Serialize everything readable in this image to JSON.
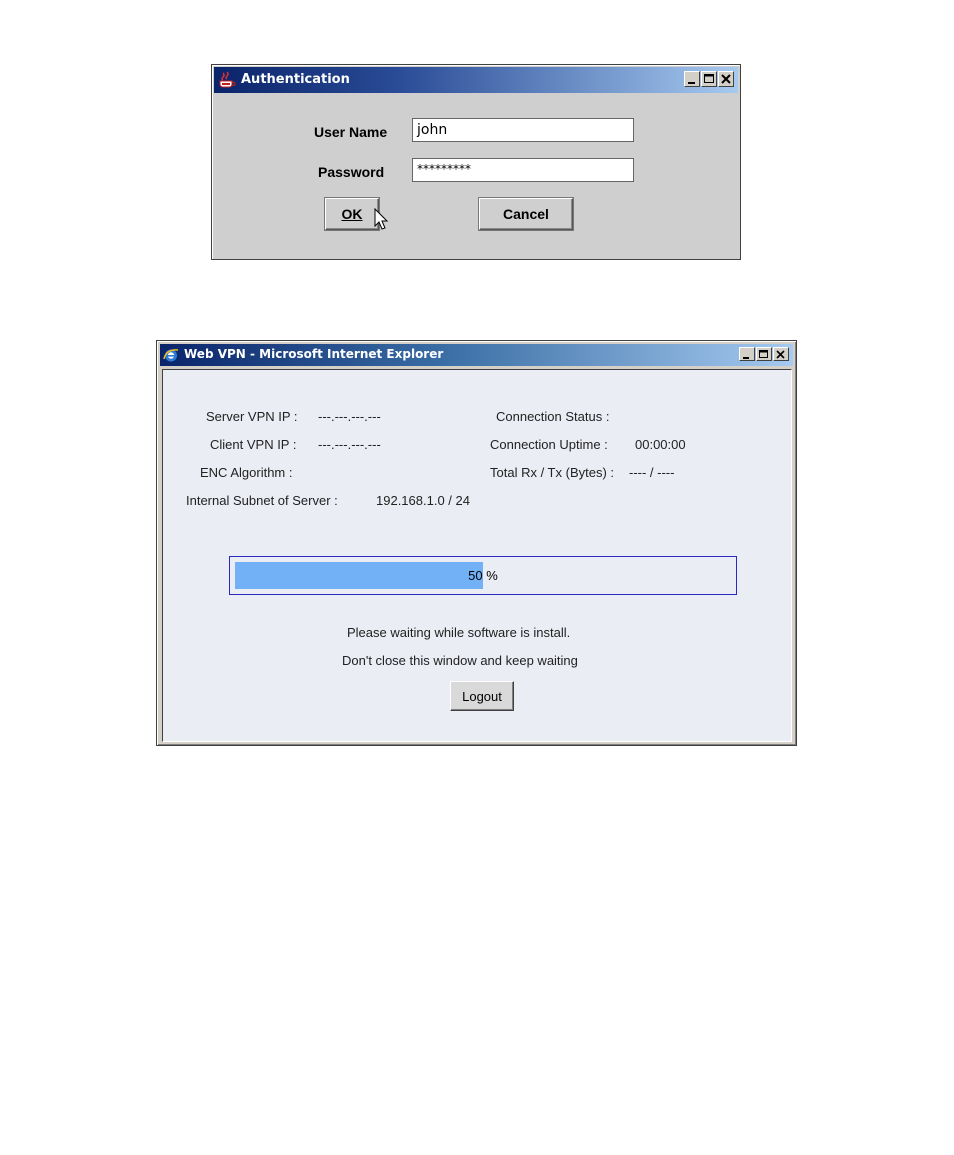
{
  "auth_dialog": {
    "title": "Authentication",
    "icon": "java-coffee-cup-icon",
    "username_label": "User Name",
    "username_value": "john",
    "password_label": "Password",
    "password_value": "*********",
    "ok_label": "OK",
    "cancel_label": "Cancel"
  },
  "vpn_window": {
    "title": "Web VPN - Microsoft Internet Explorer",
    "icon": "internet-explorer-icon",
    "server_vpn_ip_label": "Server VPN IP :",
    "server_vpn_ip_value": "---.---.---.---",
    "client_vpn_ip_label": "Client VPN IP :",
    "client_vpn_ip_value": "---.---.---.---",
    "enc_algorithm_label": "ENC Algorithm :",
    "internal_subnet_label": "Internal Subnet of Server :",
    "internal_subnet_value": "192.168.1.0 / 24",
    "connection_status_label": "Connection Status :",
    "connection_uptime_label": "Connection Uptime :",
    "connection_uptime_value": "00:00:00",
    "total_rxtx_label": "Total Rx / Tx (Bytes) :",
    "total_rxtx_value": "---- / ----",
    "progress_percent": 50,
    "progress_text": "50 %",
    "message_line1": "Please waiting while software is install.",
    "message_line2": "Don't close this window and keep waiting",
    "logout_label": "Logout"
  },
  "colors": {
    "titlebar_dark": "#0a246a",
    "titlebar_light": "#a6caf0",
    "progress_fill": "#72b1f6",
    "progress_border": "#2a2ac0",
    "content_background": "#ebedf5"
  }
}
